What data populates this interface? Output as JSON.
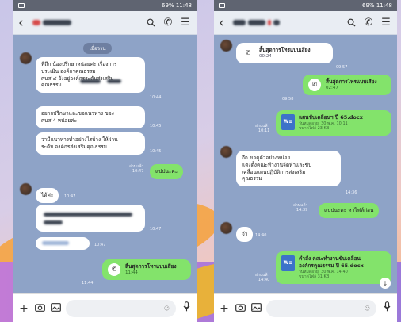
{
  "left": {
    "status_right": "69% 11:48",
    "date_pill": "เมื่อวาน",
    "msg1": [
      "พี่ถึก น้องปรึกษาหน่อยค่ะ เรื่องการ",
      "ประเมิน องค์กรคุณธรรม",
      "ศนส.๔ ยังอยู่องค์กรระดับส่งเสริม",
      "คุณธรรม"
    ],
    "msg1_time": "10:44",
    "msg2": [
      "อยากปรึกษาและขอแนวทาง ของ",
      "ศนส.4 หน่อยค่ะ"
    ],
    "msg2_time": "10:45",
    "msg3": [
      "วามีแนวทางทำอย่างไรบ้าง ให้ผ่าน",
      "ระดับ องค์กรส่งเสริมคุณธรรม"
    ],
    "msg3_time": "10:45",
    "out1_read": "อ่านแล้ว",
    "out1_time": "10:47",
    "out1": "แปปนะคะ",
    "msg4": "ได้ค่ะ",
    "msg4_time": "10:47",
    "msg6_time": "10:47",
    "call_title": "สิ้นสุดการโทรแบบเสียง",
    "call_dur": "11:44",
    "call_time": "11:44"
  },
  "right": {
    "status_right": "69% 11:48",
    "call1_title": "สิ้นสุดการโทรแบบเสียง",
    "call1_dur": "00:24",
    "call1_time": "09:57",
    "call2_title": "สิ้นสุดการโทรแบบเสียง",
    "call2_dur": "02:47",
    "call2_time": "09:58",
    "file1_name": "แผนขับเคลื่อนฯ ปี 65.docx",
    "file1_meta1": "วันหมดอายุ: 30 พ.ค. 10:11",
    "file1_meta2": "ขนาดไฟล์ 23 KB",
    "file1_read": "อ่านแล้ว",
    "file1_time": "10:11",
    "msg1": [
      "ถึก ขอดูตัวอย่างหน่อย",
      "แต่งตั้งคณะทำงานจัดทำและขับ",
      "เคลื่อนแผนปฏิบัติการส่งเสริม",
      "คุณธรรม"
    ],
    "msg1_time": "14:36",
    "out1_read": "อ่านแล้ว",
    "out1_time": "14:39",
    "out1": "แปปนะคะ หาไฟล์ก่อน",
    "msg2": "จ้า",
    "msg2_time": "14:40",
    "file2_name1": "คำสั่ง คณะทำงานขับเคลื่อน",
    "file2_name2": "องค์กรคุณธรรม ปี 65.docx",
    "file2_meta1": "วันหมดอายุ: 30 พ.ค. 14:40",
    "file2_meta2": "ขนาดไฟล์ 31 KB",
    "file2_read": "อ่านแล้ว",
    "file2_time": "14:40"
  },
  "icons": {
    "back": "back-arrow-icon",
    "search": "search-icon",
    "call": "phone-icon",
    "menu": "menu-icon",
    "plus": "plus-icon",
    "camera": "camera-icon",
    "image": "image-icon",
    "emoji": "emoji-icon",
    "mic": "mic-icon",
    "download": "download-arrow-icon"
  },
  "colors": {
    "chat_bg": "#8ea3c7",
    "bubble_out": "#83e36b",
    "bubble_in": "#ffffff",
    "topbar": "#e9edf3"
  }
}
